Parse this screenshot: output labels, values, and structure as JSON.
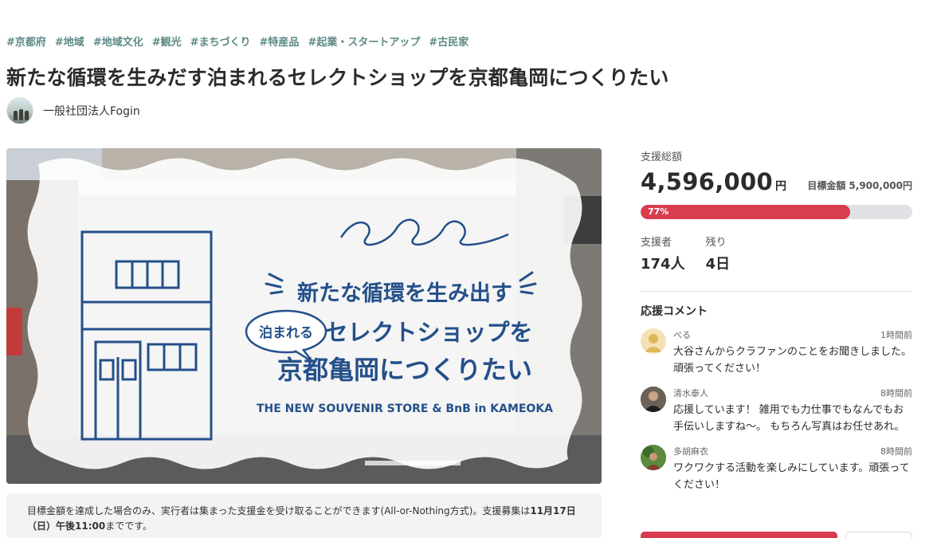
{
  "tags": [
    "#京都府",
    "#地域",
    "#地域文化",
    "#観光",
    "#まちづくり",
    "#特産品",
    "#起業・スタートアップ",
    "#古民家"
  ],
  "project": {
    "title": "新たな循環を生みだす泊まれるセレクトショップを京都亀岡につくりたい",
    "owner": "一般社団法人Fogin"
  },
  "hero": {
    "line1": "新たな循環を生み出す",
    "badge": "泊まれる",
    "line2": "セレクトショップを",
    "line3": "京都亀岡につくりたい",
    "english": "THE NEW SOUVENIR STORE & BnB in KAMEOKA"
  },
  "notice": {
    "text": "目標金額を達成した場合のみ、実行者は集まった支援金を受け取ることができます(All-or-Nothing方式)。支援募集は",
    "deadline": "11月17日（日）午後11:00",
    "suffix": "までです。"
  },
  "funding": {
    "total_label": "支援総額",
    "total": "4,596,000",
    "currency": "円",
    "goal_label": "目標金額",
    "goal": "5,900,000円",
    "progress_percent": 77,
    "progress_text": "77%",
    "backers_label": "支援者",
    "backers": "174人",
    "remaining_label": "残り",
    "remaining": "4日"
  },
  "comments": {
    "heading": "応援コメント",
    "items": [
      {
        "user": "べる",
        "time": "1時間前",
        "text": "大谷さんからクラファンのことをお聞きしました。頑張ってください！",
        "avatar": "default-avatar-icon"
      },
      {
        "user": "清水泰人",
        "time": "8時間前",
        "text": "応援しています！ 雑用でも力仕事でもなんでもお手伝いしますね〜。 もちろん写真はお任せあれ。",
        "avatar": "photo"
      },
      {
        "user": "多胡麻衣",
        "time": "8時間前",
        "text": "ワクワクする活動を楽しみにしています。頑張ってください！",
        "avatar": "photo"
      }
    ]
  },
  "colors": {
    "accent": "#d83c4e",
    "tag": "#5c8a86",
    "hero_ink": "#24508a"
  }
}
